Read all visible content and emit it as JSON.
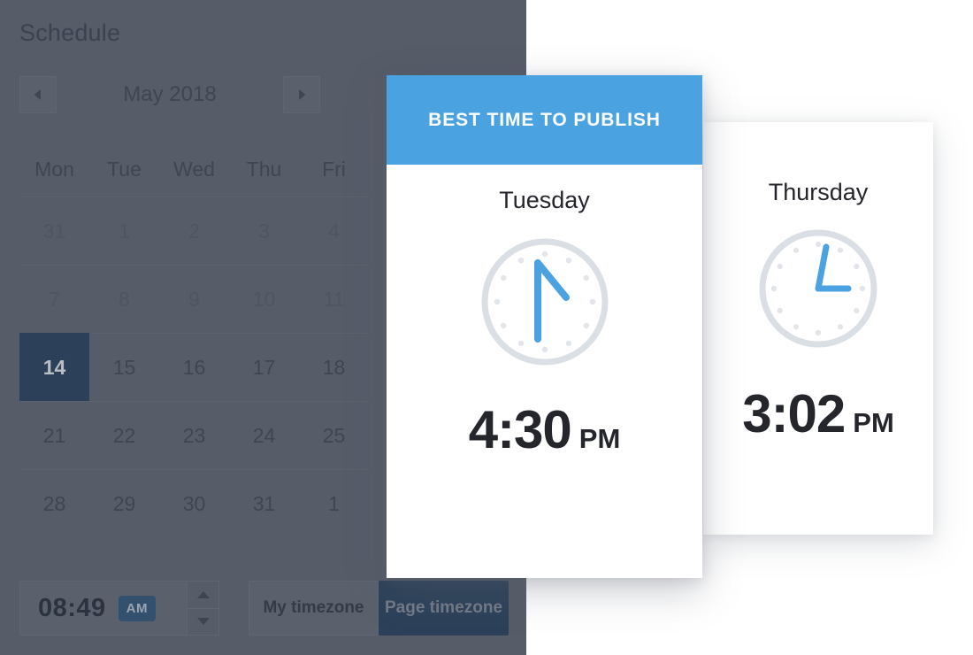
{
  "schedule": {
    "title": "Schedule",
    "nav": {
      "prev_label": "◂",
      "next_label": "▸",
      "month_label": "May 2018"
    },
    "weekdays": [
      "Mon",
      "Tue",
      "Wed",
      "Thu",
      "Fri"
    ],
    "weeks": [
      [
        {
          "d": "31",
          "muted": true
        },
        {
          "d": "1",
          "muted": true
        },
        {
          "d": "2",
          "muted": true
        },
        {
          "d": "3",
          "muted": true
        },
        {
          "d": "4",
          "muted": true
        }
      ],
      [
        {
          "d": "7",
          "muted": true
        },
        {
          "d": "8",
          "muted": true
        },
        {
          "d": "9",
          "muted": true
        },
        {
          "d": "10",
          "muted": true
        },
        {
          "d": "11",
          "muted": true
        }
      ],
      [
        {
          "d": "14",
          "selected": true
        },
        {
          "d": "15"
        },
        {
          "d": "16"
        },
        {
          "d": "17"
        },
        {
          "d": "18"
        }
      ],
      [
        {
          "d": "21"
        },
        {
          "d": "22"
        },
        {
          "d": "23"
        },
        {
          "d": "24"
        },
        {
          "d": "25"
        }
      ],
      [
        {
          "d": "28"
        },
        {
          "d": "29"
        },
        {
          "d": "30"
        },
        {
          "d": "31"
        },
        {
          "d": "1"
        }
      ]
    ],
    "selected_day": "14",
    "time_picker": {
      "value": "08:49",
      "meridiem": "AM",
      "increase_label": "▴",
      "decrease_label": "▾"
    },
    "timezone_buttons": [
      {
        "label": "My timezone",
        "active": false
      },
      {
        "label": "Page timezone",
        "active": true
      }
    ]
  },
  "main_card": {
    "header": "BEST TIME TO PUBLISH",
    "day": "Tuesday",
    "time": "4:30",
    "meridiem": "PM",
    "clock": {
      "hour_angle": 135,
      "minute_angle": 180
    }
  },
  "secondary_card": {
    "day": "Thursday",
    "time": "3:02",
    "meridiem": "PM",
    "clock": {
      "hour_angle": 91,
      "minute_angle": 12
    }
  },
  "colors": {
    "accent_blue": "#4aa3e0",
    "panel_dark": "#565c68",
    "selected_navy": "#2c4159",
    "clock_face": "#dcdfe5",
    "clock_hand": "#4aa3e0",
    "text_dark": "#24262b"
  }
}
